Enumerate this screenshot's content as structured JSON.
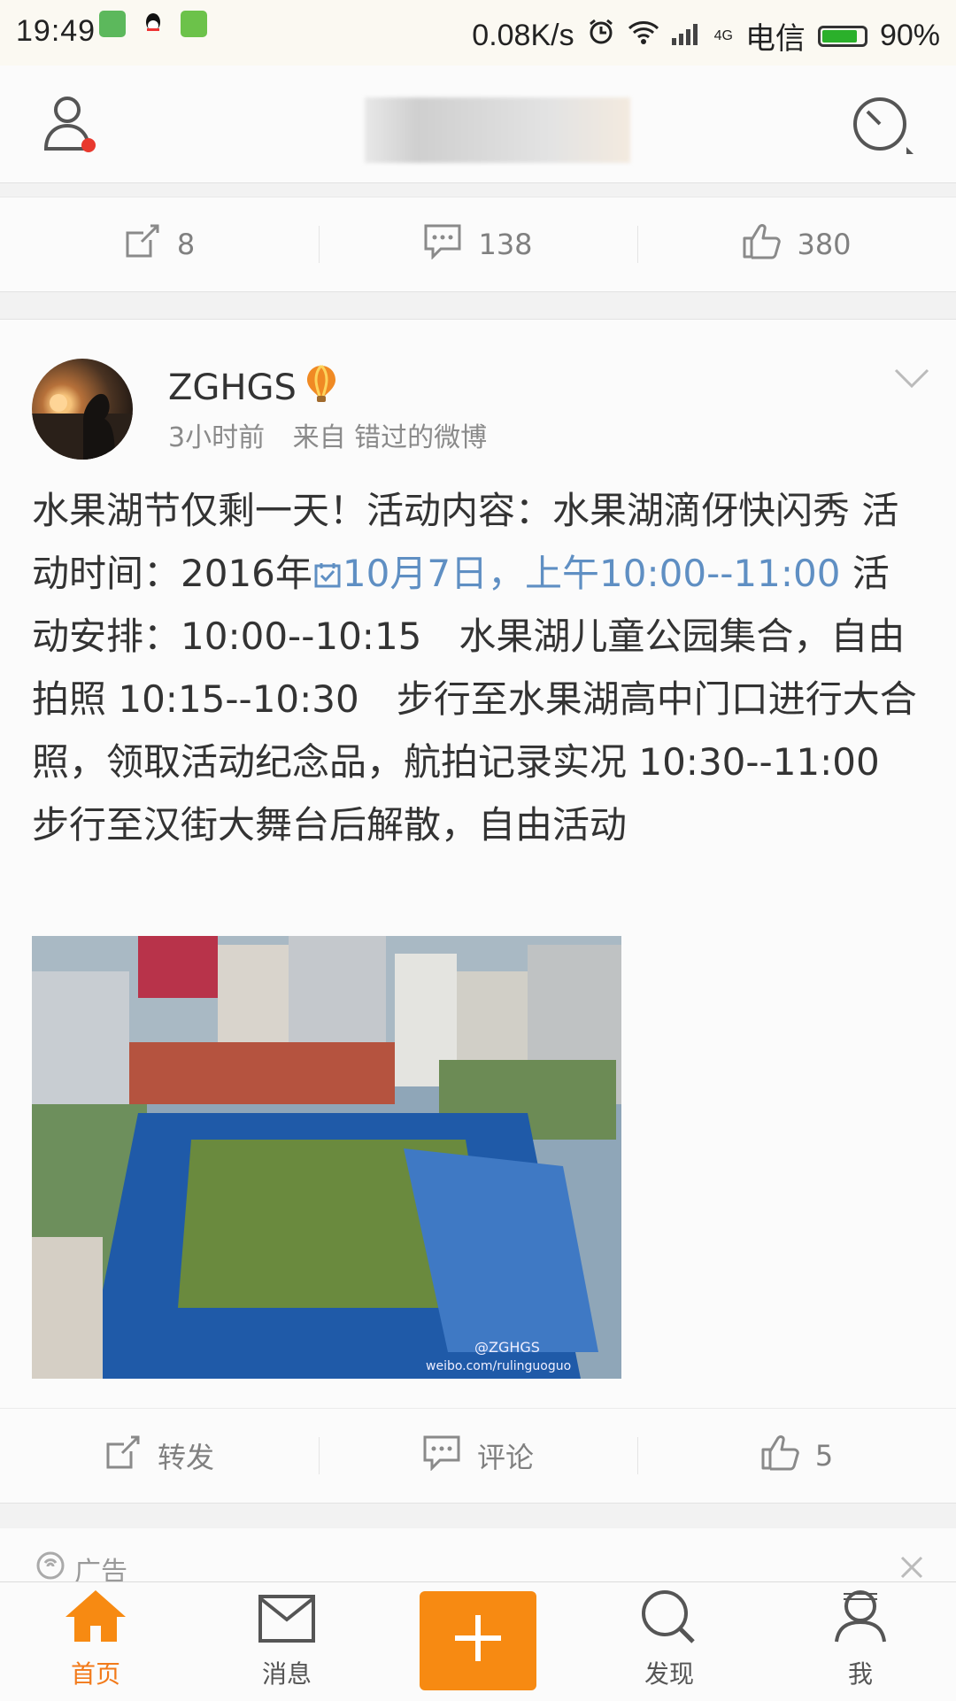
{
  "status_bar": {
    "time": "19:49",
    "network_speed": "0.08K/s",
    "signal_type": "4G",
    "carrier": "电信",
    "battery_percent": "90%",
    "battery_level": 0.9
  },
  "top_action_bar": {
    "repost_count": "8",
    "comment_count": "138",
    "like_count": "380"
  },
  "post": {
    "username": "ZGHGS",
    "time_ago": "3小时前",
    "source": "来自 错过的微博",
    "text_part1": "水果湖节仅剩一天！活动内容：水果湖滴伢快闪秀 活动时间：2016年",
    "text_link": "10月7日，上午10:00--11:00",
    "text_part2": "  活动安排：10:00--10:15　水果湖儿童公园集合，自由拍照 10:15--10:30　步行至水果湖高中门口进行大合照，领取活动纪念品，航拍记录实况 10:30--11:00　步行至汉街大舞台后解散，自由活动",
    "image_watermark": "@ZGHGS",
    "image_watermark_url": "weibo.com/rulinguoguo"
  },
  "post_actions": {
    "repost_label": "转发",
    "comment_label": "评论",
    "like_count": "5"
  },
  "next_card": {
    "label": "广告"
  },
  "tab_bar": {
    "tabs": [
      {
        "label": "首页"
      },
      {
        "label": "消息"
      },
      {
        "label": ""
      },
      {
        "label": "发现"
      },
      {
        "label": "我"
      }
    ]
  },
  "colors": {
    "accent": "#f78a12",
    "link": "#5f8fc3",
    "active_tab": "#f27a1a"
  }
}
